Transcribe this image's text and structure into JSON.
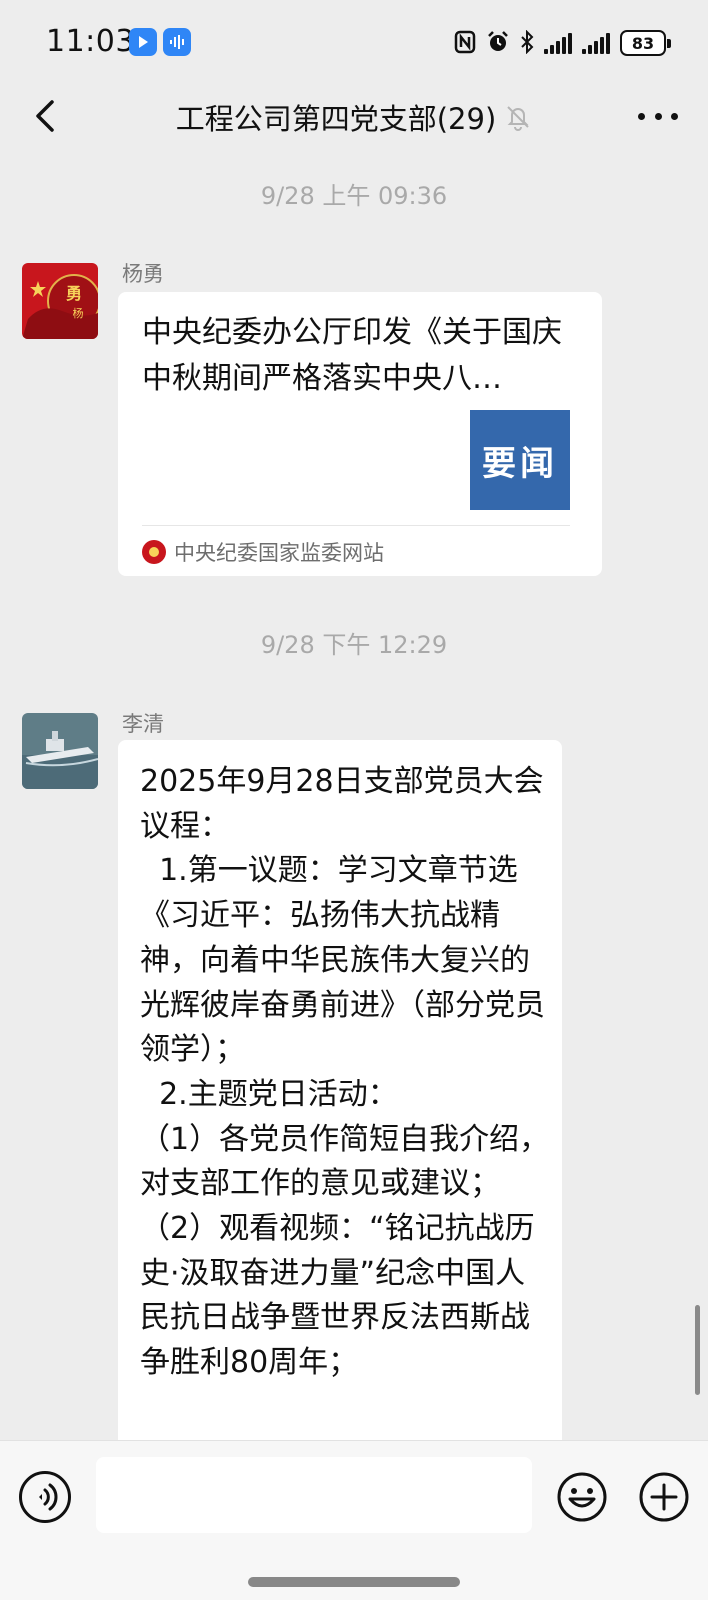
{
  "status_bar": {
    "time": "11:03",
    "battery": "83",
    "icons": [
      "nfc-icon",
      "alarm-icon",
      "bluetooth-icon",
      "signal-icon",
      "signal-icon"
    ]
  },
  "header": {
    "title": "工程公司第四党支部(29)",
    "back_icon": "back-arrow-icon",
    "mute_icon": "bell-muted-icon",
    "more_icon": "more-dots-icon"
  },
  "messages": [
    {
      "timestamp": "9/28 上午 09:36",
      "sender": "杨勇",
      "type": "link-card",
      "card": {
        "title": "中央纪委办公厅印发《关于国庆中秋期间严格落实中央八…",
        "thumb_text": "要闻",
        "thumb_color": "#3468ac",
        "source": "中央纪委国家监委网站"
      }
    },
    {
      "timestamp": "9/28 下午 12:29",
      "sender": "李清",
      "type": "text",
      "text": "2025年9月28日支部党员大会议程：\n  1.第一议题：学习文章节选《习近平：弘扬伟大抗战精神，向着中华民族伟大复兴的光辉彼岸奋勇前进》（部分党员领学）；\n  2.主题党日活动：\n（1）各党员作简短自我介绍，对支部工作的意见或建议；\n（2）观看视频：“铭记抗战历史·汲取奋进力量”纪念中国人民抗日战争暨世界反法西斯战争胜利80周年；"
    }
  ],
  "input_bar": {
    "voice_icon": "voice-icon",
    "emoji_icon": "emoji-icon",
    "plus_icon": "plus-icon",
    "input_value": ""
  }
}
